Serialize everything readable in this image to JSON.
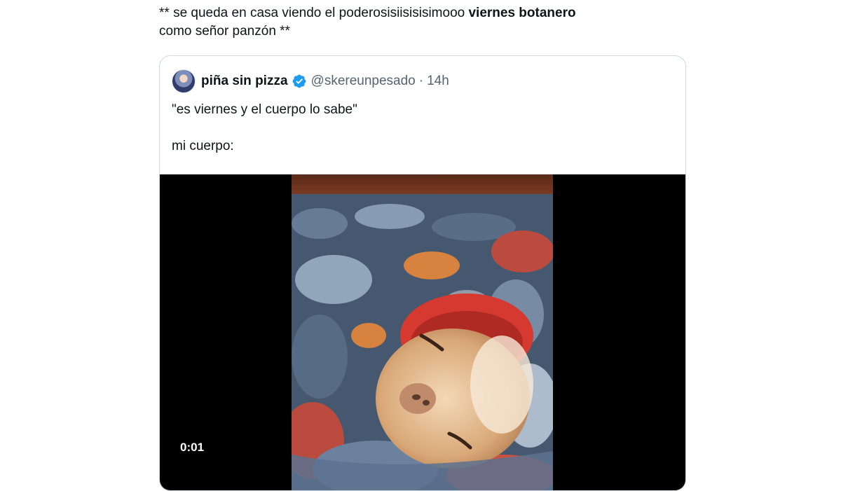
{
  "tweet": {
    "text_part1": "** se queda en casa viendo el poderosisiisisisimooo ",
    "text_bold": "viernes botanero",
    "text_part2": "como señor panzón **"
  },
  "quote": {
    "display_name": "piña sin pizza",
    "handle": "@skereunpesado",
    "separator": "·",
    "time": "14h",
    "text": "\"es viernes y el cuerpo lo sabe\"\n\nmi cuerpo:",
    "media": {
      "duration": "0:01"
    }
  },
  "colors": {
    "verified": "#1d9bf0",
    "border": "#cfd9de",
    "secondary_text": "#536471"
  }
}
